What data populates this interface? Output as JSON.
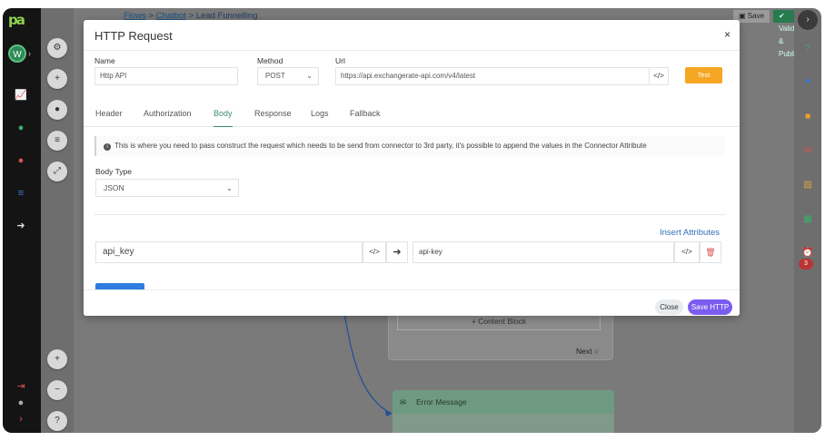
{
  "app": {
    "logo_text": "pa",
    "user_initial": "W"
  },
  "breadcrumb": {
    "items": [
      "Flows",
      "Chatbot",
      "Lead Funnelling"
    ],
    "separator": ">"
  },
  "topbar": {
    "save_label": "Save",
    "publish_label": "Validate & Publish"
  },
  "canvas": {
    "content_block_label": "+ Content Block",
    "next_label": "Next",
    "error_card_title": "Error Message"
  },
  "right_panel": {
    "badge_count": "3"
  },
  "modal": {
    "title": "HTTP Request",
    "close_symbol": "×",
    "name_label": "Name",
    "name_value": "Http API",
    "method_label": "Method",
    "method_value": "POST",
    "url_label": "Url",
    "url_value": "https://api.exchangerate-api.com/v4/latest",
    "code_symbol": "</>",
    "test_label": "Test",
    "tabs": [
      "Header",
      "Authorization",
      "Body",
      "Response",
      "Logs",
      "Fallback"
    ],
    "active_tab": "Body",
    "info_text": "This is where you need to pass construct the request which needs to be send from connector to 3rd party, it's possible to append the values in the Connector Attribute",
    "body_type_label": "Body Type",
    "body_type_value": "JSON",
    "insert_attributes_label": "Insert Attributes",
    "param_key": "api_key",
    "param_value": "api-key",
    "close_button_label": "Close",
    "save_button_label": "Save HTTP"
  },
  "colors": {
    "accent_green": "#3a8b6a",
    "save_purple": "#7a5cf0",
    "test_orange": "#f5a623",
    "link_blue": "#2f6fb8"
  }
}
